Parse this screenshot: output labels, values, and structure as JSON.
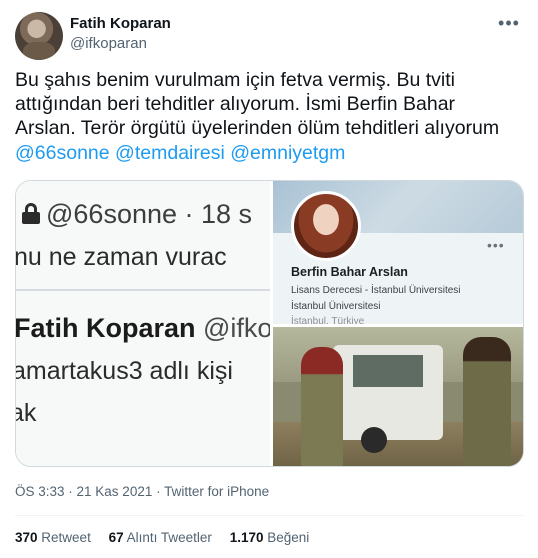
{
  "author": {
    "display_name": "Fatih Koparan",
    "handle": "@ifkoparan"
  },
  "more_icon": "more-horizontal-icon",
  "tweet": {
    "text_plain": "Bu şahıs benim vurulmam için fetva vermiş. Bu tviti attığından beri tehditler alıyorum. İsmi Berfin Bahar Arslan. Terör örgütü üyelerinden ölüm tehditleri alıyorum",
    "mentions": [
      "@66sonne",
      "@temdairesi",
      "@emniyetgm"
    ]
  },
  "media": {
    "screenshot": {
      "line1": "@66sonne · 18 s",
      "line2": "nu ne zaman vurac",
      "line3_name": "Fatih Koparan",
      "line3_handle": " @ifko",
      "line4": "amartakus3 adlı kişi",
      "line5": "ak"
    },
    "profile_card": {
      "name": "Berfin Bahar Arslan",
      "line1": "Lisans Derecesi - İstanbul Üniversitesi",
      "line2": "İstanbul Üniversitesi",
      "line3": "İstanbul, Türkiye"
    }
  },
  "meta": {
    "time": "ÖS 3:33",
    "dot": " · ",
    "date": "21 Kas 2021",
    "client": "Twitter for iPhone"
  },
  "stats": {
    "retweets_count": "370",
    "retweets_label": "Retweet",
    "quotes_count": "67",
    "quotes_label": "Alıntı Tweetler",
    "likes_count": "1.170",
    "likes_label": "Beğeni"
  },
  "colors": {
    "accent": "#1d9bf0",
    "text": "#0f1419",
    "secondary": "#536471"
  }
}
